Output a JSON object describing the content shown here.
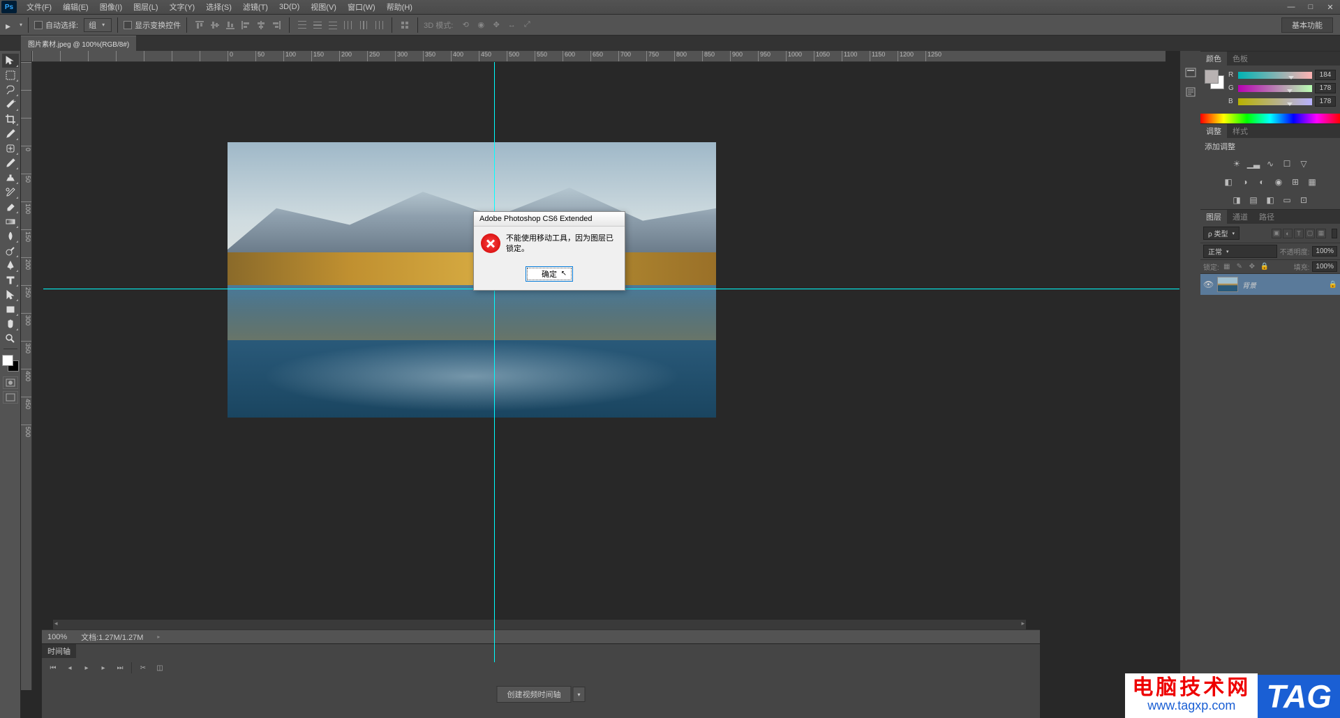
{
  "app": {
    "logo": "Ps"
  },
  "menubar": {
    "items": [
      "文件(F)",
      "编辑(E)",
      "图像(I)",
      "图层(L)",
      "文字(Y)",
      "选择(S)",
      "滤镜(T)",
      "3D(D)",
      "视图(V)",
      "窗口(W)",
      "帮助(H)"
    ]
  },
  "options": {
    "auto_select_label": "自动选择:",
    "auto_select_value": "组",
    "show_transform": "显示变换控件",
    "mode_3d_label": "3D 模式:",
    "basic_functions": "基本功能"
  },
  "document": {
    "tab": "图片素材.jpeg @ 100%(RGB/8#)"
  },
  "ruler_h_values": [
    "0",
    "50",
    "100",
    "150",
    "200",
    "250",
    "300",
    "350",
    "400",
    "450",
    "500",
    "550",
    "600",
    "650",
    "700",
    "750",
    "800",
    "850",
    "900",
    "950",
    "1000",
    "1050",
    "1100",
    "1150",
    "1200",
    "1250"
  ],
  "ruler_v_values": [
    "0",
    "50",
    "100",
    "150",
    "200",
    "250",
    "300",
    "350",
    "400",
    "450",
    "500"
  ],
  "status": {
    "zoom": "100%",
    "doc_label": "文档:",
    "doc_value": "1.27M/1.27M"
  },
  "timeline": {
    "tab": "时间轴",
    "create_btn": "创建视频时间轴"
  },
  "panels": {
    "color": {
      "tab1": "颜色",
      "tab2": "色板",
      "r": "R",
      "g": "G",
      "b": "B",
      "r_val": "184",
      "g_val": "178",
      "b_val": "178"
    },
    "adjustments": {
      "tab1": "调整",
      "tab2": "样式",
      "title": "添加调整"
    },
    "layers": {
      "tab1": "图层",
      "tab2": "通道",
      "tab3": "路径",
      "filter_type": "ρ 类型",
      "blend_mode": "正常",
      "opacity_label": "不透明度:",
      "opacity_val": "100%",
      "lock_label": "锁定:",
      "fill_label": "填充:",
      "fill_val": "100%",
      "layer_name": "背景"
    }
  },
  "dialog": {
    "title": "Adobe Photoshop CS6 Extended",
    "message": "不能使用移动工具，因为图层已锁定。",
    "ok": "确定"
  },
  "watermark": {
    "chinese": "电脑技术网",
    "url": "www.tagxp.com",
    "tag": "TAG"
  }
}
